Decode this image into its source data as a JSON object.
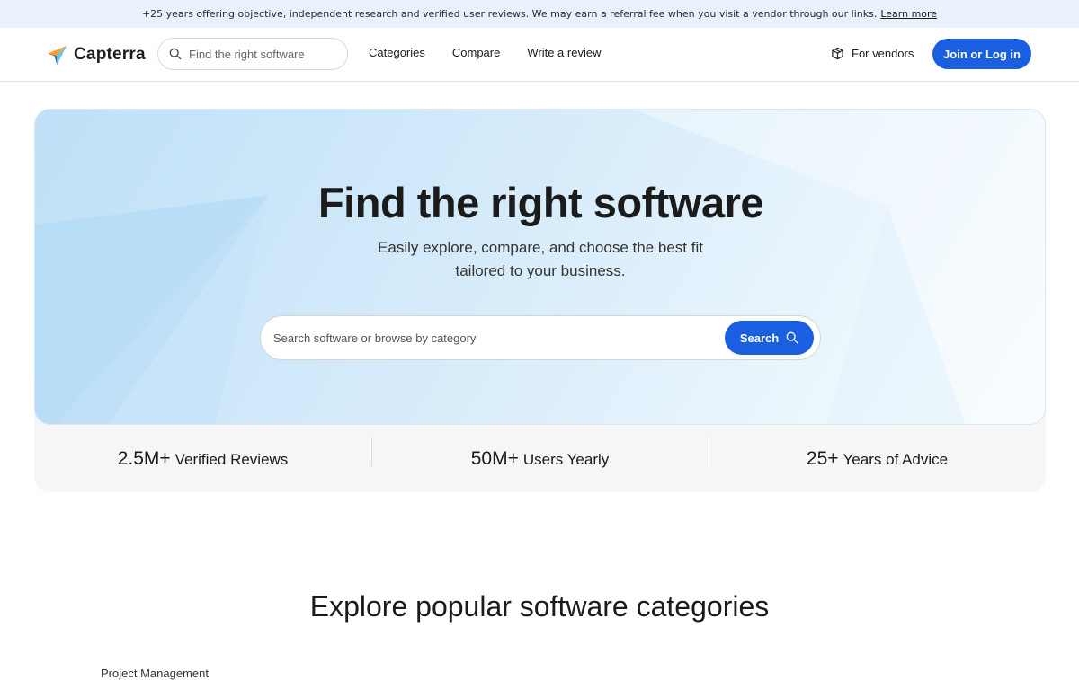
{
  "banner": {
    "text": "+25 years offering objective, independent research and verified user reviews. We may earn a referral fee when you visit a vendor through our links.",
    "link": "Learn more"
  },
  "header": {
    "logo_text": "Capterra",
    "search_placeholder": "Find the right software",
    "nav": [
      "Categories",
      "Compare",
      "Write a review"
    ],
    "vendors_label": "For vendors",
    "join_label": "Join or Log in"
  },
  "hero": {
    "title": "Find the right software",
    "subtitle_line1": "Easily explore, compare, and choose the best fit",
    "subtitle_line2": "tailored to your business.",
    "search_placeholder": "Search software or browse by category",
    "search_button": "Search"
  },
  "stats": [
    {
      "value": "2.5M+",
      "label": "Verified Reviews"
    },
    {
      "value": "50M+",
      "label": "Users Yearly"
    },
    {
      "value": "25+",
      "label": "Years of Advice"
    }
  ],
  "section": {
    "title": "Explore popular software categories",
    "first_item": "Project Management"
  },
  "colors": {
    "brand_blue": "#1a5fe0",
    "banner_bg": "#e9f2fc"
  }
}
